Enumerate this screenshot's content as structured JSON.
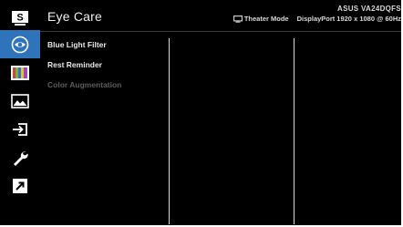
{
  "header": {
    "title": "Eye Care",
    "model": "ASUS VA24DQFS",
    "mode": "Theater Mode",
    "input": "DisplayPort",
    "resolution": "1920 x 1080 @ 60Hz"
  },
  "sidebar": {
    "items": [
      {
        "name": "splendid",
        "label": "S",
        "icon": "splendid-icon",
        "active": false
      },
      {
        "name": "eye-care",
        "icon": "eye-icon",
        "active": true
      },
      {
        "name": "color",
        "icon": "color-bars-icon",
        "active": false
      },
      {
        "name": "image",
        "icon": "image-icon",
        "active": false
      },
      {
        "name": "input-select",
        "icon": "input-icon",
        "active": false
      },
      {
        "name": "system-setup",
        "icon": "wrench-icon",
        "active": false
      },
      {
        "name": "shortcut",
        "icon": "shortcut-arrow-icon",
        "active": false
      }
    ]
  },
  "menu": {
    "items": [
      {
        "label": "Blue Light Filter",
        "enabled": true
      },
      {
        "label": "Rest Reminder",
        "enabled": true
      },
      {
        "label": "Color Augmentation",
        "enabled": false
      }
    ]
  },
  "colors": {
    "accent": "#2f74bb",
    "background": "#000000",
    "text": "#e8e8e8",
    "disabled_text": "#5c5c5c"
  }
}
